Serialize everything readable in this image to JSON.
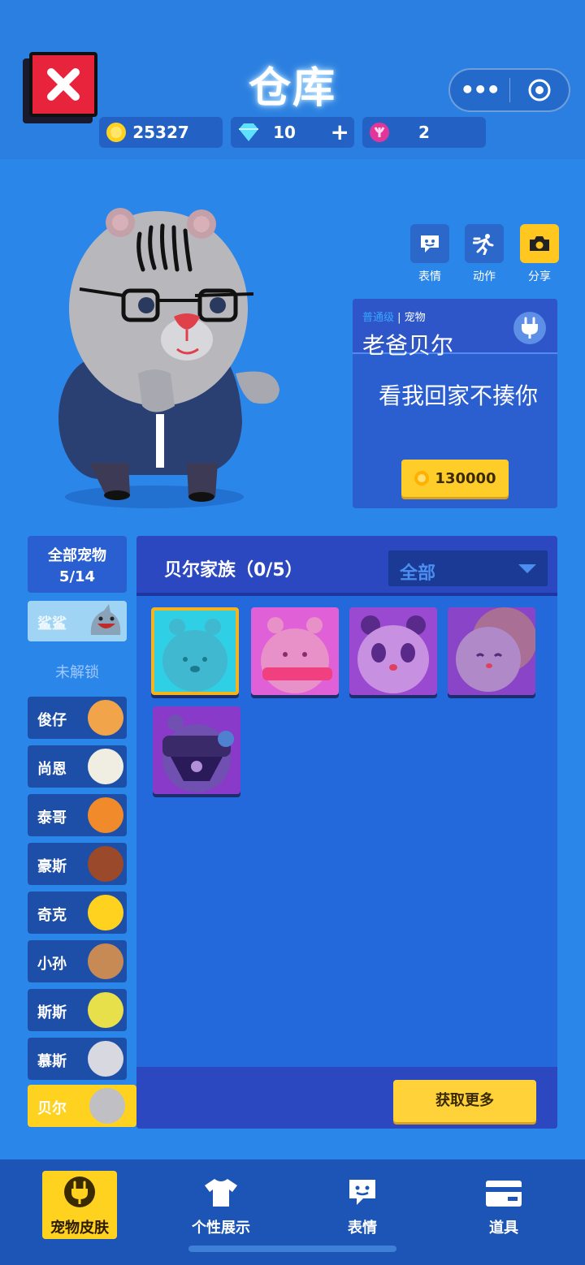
{
  "header": {
    "title": "仓库",
    "close_icon": "close-icon",
    "menu_icon": "more-dots-icon",
    "target_icon": "target-icon"
  },
  "currency": {
    "coins": "25327",
    "gems": "10",
    "gem_plus": "+",
    "candy": "2"
  },
  "actions": [
    {
      "label": "表情",
      "icon": "emote-icon"
    },
    {
      "label": "动作",
      "icon": "run-icon"
    },
    {
      "label": "分享",
      "icon": "camera-icon"
    }
  ],
  "pet_info": {
    "tier": "普通级",
    "tier_sep": "| 宠物",
    "name": "老爸贝尔",
    "quote": "看我回家不揍你",
    "price": "130000"
  },
  "sidebar": {
    "all_label": "全部宠物",
    "all_count": "5/14",
    "shark_label": "鲨鲨",
    "locked_label": "未解锁",
    "items": [
      {
        "label": "俊仔",
        "color": "#f2a44a"
      },
      {
        "label": "尚恩",
        "color": "#f0ede2"
      },
      {
        "label": "泰哥",
        "color": "#f08a2a"
      },
      {
        "label": "豪斯",
        "color": "#9a4a2a"
      },
      {
        "label": "奇克",
        "color": "#ffd21f"
      },
      {
        "label": "小孙",
        "color": "#c88a55"
      },
      {
        "label": "斯斯",
        "color": "#e8e04a"
      },
      {
        "label": "慕斯",
        "color": "#d8d8e0"
      },
      {
        "label": "贝尔",
        "color": "#bfbfc4"
      }
    ]
  },
  "panel": {
    "family": "贝尔家族（0/5）",
    "filter": "全部",
    "get_more": "获取更多",
    "skins": [
      {
        "name": "cyan-bear",
        "bg": "#2fd0e6",
        "body": "#3fb8d0"
      },
      {
        "name": "pink-bear",
        "bg": "#e060d8",
        "body": "#e890c8"
      },
      {
        "name": "panda",
        "bg": "#9a4ad0",
        "body": "#c890e0"
      },
      {
        "name": "buddha-bear",
        "bg": "#8a44c8",
        "body": "#b08ac8"
      },
      {
        "name": "skull-mask-bear",
        "bg": "#8a3ac8",
        "body": "#7050b0"
      }
    ]
  },
  "bottom_nav": [
    {
      "label": "宠物皮肤",
      "icon": "pet-plug-icon"
    },
    {
      "label": "个性展示",
      "icon": "shirt-icon"
    },
    {
      "label": "表情",
      "icon": "emote-icon"
    },
    {
      "label": "道具",
      "icon": "card-icon"
    }
  ]
}
